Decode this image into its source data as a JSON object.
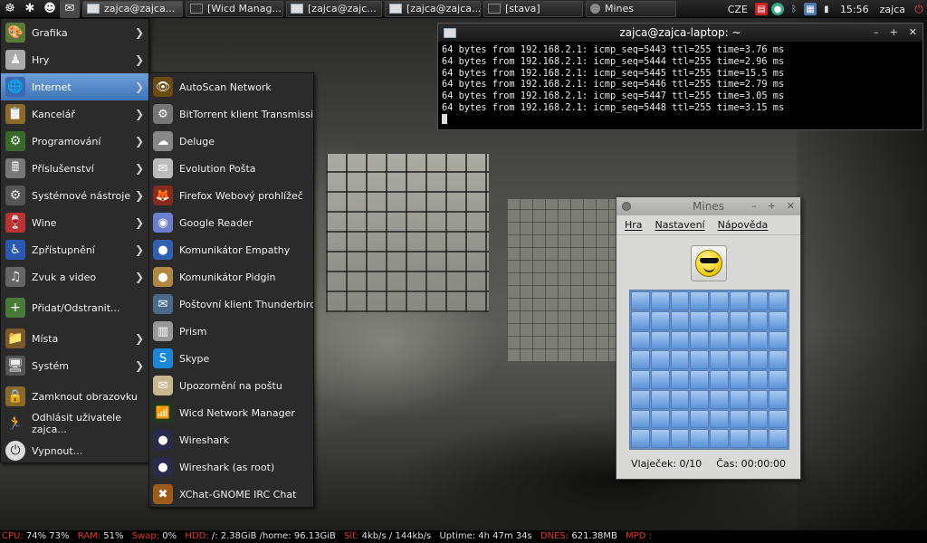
{
  "top_panel": {
    "launchers": [
      {
        "name": "main-menu-icon",
        "glyph": "☸"
      },
      {
        "name": "settings-icon",
        "glyph": "✱"
      },
      {
        "name": "emoticon-icon",
        "glyph": "☻"
      },
      {
        "name": "mail-icon",
        "glyph": "✉"
      }
    ],
    "tasks": [
      {
        "label": "zajca@zajca...",
        "active": true,
        "icon": "terminal"
      },
      {
        "label": "[Wicd Manag...",
        "active": false,
        "icon": "wicd"
      },
      {
        "label": "[zajca@zajc...",
        "active": false,
        "icon": "terminal"
      },
      {
        "label": "[zajca@zajca...",
        "active": false,
        "icon": "terminal"
      },
      {
        "label": "[stava]",
        "active": false,
        "icon": "document"
      },
      {
        "label": "Mines",
        "active": false,
        "icon": "mines"
      }
    ],
    "keyboard_layout": "CZE",
    "clock": "15:56",
    "user": "zajca"
  },
  "main_menu": {
    "items": [
      {
        "label": "Grafika",
        "icon": "graphics-icon",
        "glyph": "🎨",
        "submenu": true,
        "selected": false
      },
      {
        "label": "Hry",
        "icon": "games-icon",
        "glyph": "♟",
        "submenu": true,
        "selected": false
      },
      {
        "label": "Internet",
        "icon": "internet-globe-icon",
        "glyph": "🌐",
        "submenu": true,
        "selected": true
      },
      {
        "label": "Kancelář",
        "icon": "office-icon",
        "glyph": "📋",
        "submenu": true,
        "selected": false
      },
      {
        "label": "Programování",
        "icon": "programming-icon",
        "glyph": "⚙",
        "submenu": true,
        "selected": false
      },
      {
        "label": "Příslušenství",
        "icon": "accessories-icon",
        "glyph": "🖩",
        "submenu": true,
        "selected": false
      },
      {
        "label": "Systémové nástroje",
        "icon": "system-tools-icon",
        "glyph": "⚙",
        "submenu": true,
        "selected": false
      },
      {
        "label": "Wine",
        "icon": "wine-icon",
        "glyph": "🍷",
        "submenu": true,
        "selected": false
      },
      {
        "label": "Zpřístupnění",
        "icon": "accessibility-icon",
        "glyph": "♿",
        "submenu": true,
        "selected": false
      },
      {
        "label": "Zvuk a video",
        "icon": "sound-video-icon",
        "glyph": "♫",
        "submenu": true,
        "selected": false
      }
    ],
    "add_remove": {
      "label": "Přidat/Odstranit...",
      "icon": "add-remove-icon",
      "glyph": "+"
    },
    "places": {
      "label": "Místa",
      "icon": "places-folder-icon",
      "glyph": "📁"
    },
    "system": {
      "label": "Systém",
      "icon": "system-icon",
      "glyph": "🖥"
    },
    "lock": {
      "label": "Zamknout obrazovku",
      "icon": "lock-icon",
      "glyph": "🔒"
    },
    "logout": {
      "label": "Odhlásit uživatele zajca...",
      "icon": "logout-icon",
      "glyph": "🏃"
    },
    "shutdown": {
      "label": "Vypnout...",
      "icon": "power-icon",
      "glyph": "⏻"
    }
  },
  "internet_submenu": {
    "items": [
      {
        "label": "AutoScan Network",
        "icon": "autoscan-icon",
        "glyph": "👁",
        "bg": "#6b4b10"
      },
      {
        "label": "BitTorrent klient Transmission",
        "icon": "transmission-icon",
        "glyph": "⚙",
        "bg": "#777"
      },
      {
        "label": "Deluge",
        "icon": "deluge-icon",
        "glyph": "☁",
        "bg": "#888"
      },
      {
        "label": "Evolution Pošta",
        "icon": "evolution-icon",
        "glyph": "✉",
        "bg": "#bbb"
      },
      {
        "label": "Firefox Webový prohlížeč",
        "icon": "firefox-icon",
        "glyph": "🦊",
        "bg": "#8a2a1a"
      },
      {
        "label": "Google Reader",
        "icon": "google-reader-icon",
        "glyph": "◉",
        "bg": "#6b7fd0"
      },
      {
        "label": "Komunikátor Empathy",
        "icon": "empathy-icon",
        "glyph": "●",
        "bg": "#3060b0"
      },
      {
        "label": "Komunikátor Pidgin",
        "icon": "pidgin-icon",
        "glyph": "●",
        "bg": "#b08840"
      },
      {
        "label": "Poštovní klient Thunderbird",
        "icon": "thunderbird-icon",
        "glyph": "✉",
        "bg": "#4a6a8a"
      },
      {
        "label": "Prism",
        "icon": "prism-icon",
        "glyph": "▥",
        "bg": "#999"
      },
      {
        "label": "Skype",
        "icon": "skype-icon",
        "glyph": "S",
        "bg": "#1a8ad8"
      },
      {
        "label": "Upozornění na poštu",
        "icon": "mail-notify-icon",
        "glyph": "✉",
        "bg": "#c8b890"
      },
      {
        "label": "Wicd Network Manager",
        "icon": "wicd-icon",
        "glyph": "📶",
        "bg": "#1a3a1a"
      },
      {
        "label": "Wireshark",
        "icon": "wireshark-icon",
        "glyph": "●",
        "bg": "#2a2a4a"
      },
      {
        "label": "Wireshark (as root)",
        "icon": "wireshark-root-icon",
        "glyph": "●",
        "bg": "#2a2a4a"
      },
      {
        "label": "XChat-GNOME IRC Chat",
        "icon": "xchat-icon",
        "glyph": "✖",
        "bg": "#a05a1a"
      }
    ]
  },
  "terminal": {
    "title": "zajca@zajca-laptop: ~",
    "lines": [
      "64 bytes from 192.168.2.1: icmp_seq=5443 ttl=255 time=3.76 ms",
      "64 bytes from 192.168.2.1: icmp_seq=5444 ttl=255 time=2.96 ms",
      "64 bytes from 192.168.2.1: icmp_seq=5445 ttl=255 time=15.5 ms",
      "64 bytes from 192.168.2.1: icmp_seq=5446 ttl=255 time=2.79 ms",
      "64 bytes from 192.168.2.1: icmp_seq=5447 ttl=255 time=3.05 ms",
      "64 bytes from 192.168.2.1: icmp_seq=5448 ttl=255 time=3.15 ms"
    ]
  },
  "mines": {
    "title": "Mines",
    "menu": [
      "Hra",
      "Nastavení",
      "Nápověda"
    ],
    "flags": "Vlaječek: 0/10",
    "time": "Čas: 00:00:00",
    "rows": 8,
    "cols": 8
  },
  "conky": {
    "cpu_label": "CPU:",
    "cpu_value": "74% 73%",
    "ram_label": "RAM:",
    "ram_value": "51%",
    "swap_label": "Swap:",
    "swap_value": "0%",
    "hdd_label": "HDD:",
    "hdd_value": "/: 2.38GiB /home: 96.13GiB",
    "net_label": "Síť:",
    "net_value": "4kb/s / 144kb/s",
    "uptime_label": "Uptime:",
    "uptime_value": "4h 47m 34s",
    "dnes_label": "DNES:",
    "dnes_value": "621.38MB",
    "mpd_label": "MPD :",
    "mpd_value": ""
  }
}
